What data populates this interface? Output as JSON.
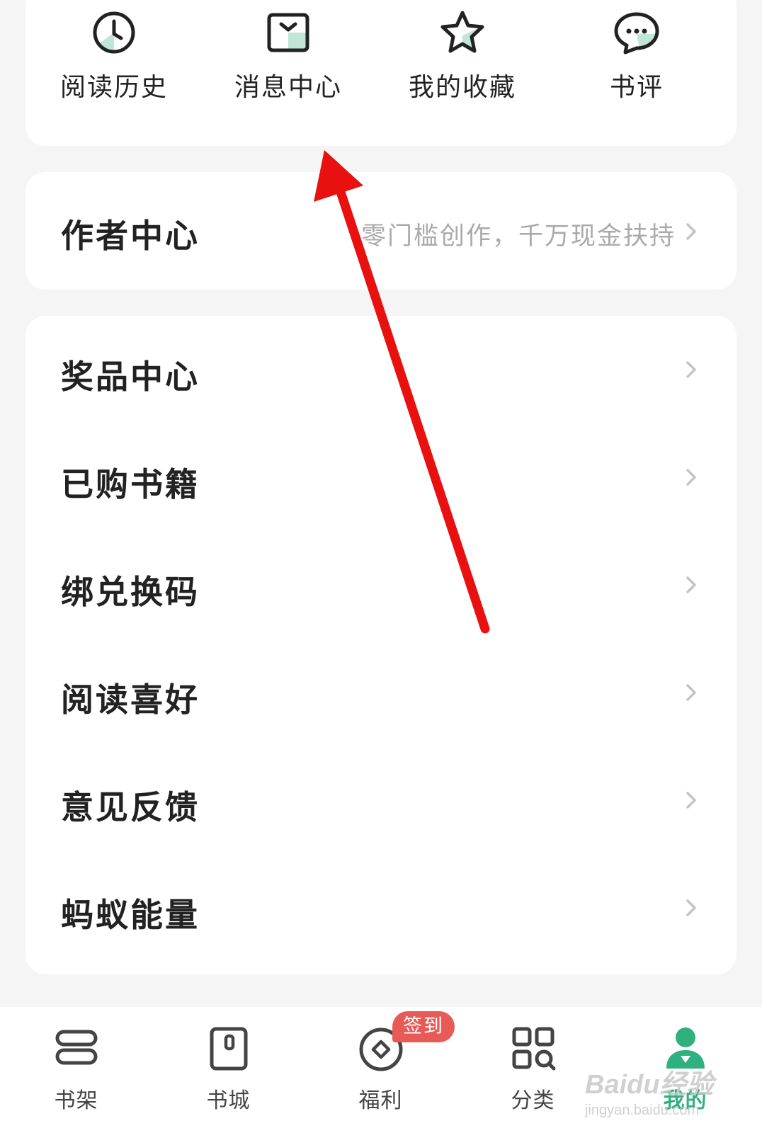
{
  "quick_access": [
    {
      "label": "阅读历史",
      "icon": "clock-icon"
    },
    {
      "label": "消息中心",
      "icon": "message-icon"
    },
    {
      "label": "我的收藏",
      "icon": "star-icon"
    },
    {
      "label": "书评",
      "icon": "comment-icon"
    }
  ],
  "author_center": {
    "title": "作者中心",
    "subtitle": "零门槛创作，千万现金扶持"
  },
  "menu": [
    {
      "label": "奖品中心"
    },
    {
      "label": "已购书籍"
    },
    {
      "label": "绑兑换码"
    },
    {
      "label": "阅读喜好"
    },
    {
      "label": "意见反馈"
    },
    {
      "label": "蚂蚁能量"
    }
  ],
  "bottom_nav": [
    {
      "label": "书架",
      "icon": "bookshelf-icon",
      "active": false
    },
    {
      "label": "书城",
      "icon": "bookstore-icon",
      "active": false
    },
    {
      "label": "福利",
      "icon": "coin-icon",
      "active": false
    },
    {
      "label": "分类",
      "icon": "category-grid-icon",
      "active": false
    },
    {
      "label": "我的",
      "icon": "profile-icon",
      "active": true
    }
  ],
  "welfare_badge": "签到",
  "watermark": {
    "main": "Baidu经验",
    "sub": "jingyan.baidu.com"
  },
  "colors": {
    "accent": "#2fb07f",
    "icon_fill": "#bfe6d6",
    "badge": "#e85a56",
    "annotation_arrow": "#e8110f"
  }
}
